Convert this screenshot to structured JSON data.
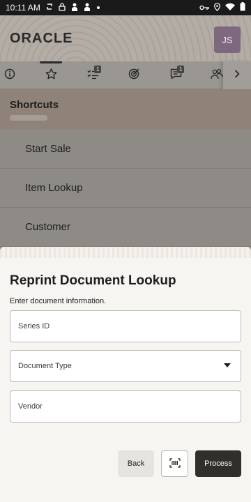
{
  "status_bar": {
    "time": "10:11 AM",
    "left_icons": [
      "sync-icon",
      "lock-icon",
      "person-icon",
      "person-icon",
      "dot-icon"
    ],
    "right_icons": [
      "key-icon",
      "location-icon",
      "wifi-icon",
      "battery-icon"
    ]
  },
  "header": {
    "logo": "ORACLE",
    "avatar_initials": "JS",
    "avatar_color": "#7d6880"
  },
  "tabs": [
    {
      "name": "info",
      "icon": "info-icon",
      "badge": ""
    },
    {
      "name": "favorites",
      "icon": "star-icon",
      "badge": "",
      "active": true
    },
    {
      "name": "tasks",
      "icon": "checklist-icon",
      "badge": "1"
    },
    {
      "name": "targets",
      "icon": "target-icon",
      "badge": ""
    },
    {
      "name": "messages",
      "icon": "chat-icon",
      "badge": "1"
    },
    {
      "name": "more",
      "icon": "group-icon",
      "badge": ""
    }
  ],
  "shortcuts": {
    "title": "Shortcuts",
    "items": [
      "Start Sale",
      "Item Lookup",
      "Customer"
    ]
  },
  "sheet": {
    "title": "Reprint Document Lookup",
    "subtitle": "Enter document information.",
    "fields": {
      "series_id": "Series ID",
      "document_type": "Document Type",
      "vendor": "Vendor"
    },
    "buttons": {
      "back": "Back",
      "process": "Process"
    }
  },
  "colors": {
    "primary_button": "#322e2b",
    "secondary_button": "#e6e3e0"
  }
}
